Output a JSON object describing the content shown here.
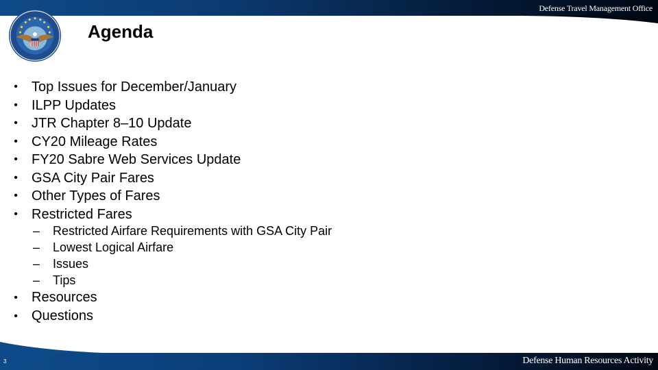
{
  "header": {
    "organization": "Defense Travel Management Office",
    "logo": "dtmo-seal-icon"
  },
  "slide": {
    "title": "Agenda",
    "items": [
      "Top Issues for December/January",
      "ILPP Updates",
      "JTR Chapter 8–10 Update",
      "CY20 Mileage Rates",
      "FY20 Sabre Web Services Update",
      "GSA City Pair Fares",
      "Other Types of Fares",
      "Restricted Fares"
    ],
    "sub_items": [
      "Restricted Airfare Requirements with GSA City Pair",
      "Lowest Logical Airfare",
      "Issues",
      "Tips"
    ],
    "items_after": [
      "Resources",
      "Questions"
    ],
    "bullet": "•",
    "dash": "–"
  },
  "footer": {
    "page_number": "3",
    "organization": "Defense Human Resources Activity"
  },
  "colors": {
    "brand_blue": "#0e4a8a",
    "dark_navy": "#010814"
  }
}
